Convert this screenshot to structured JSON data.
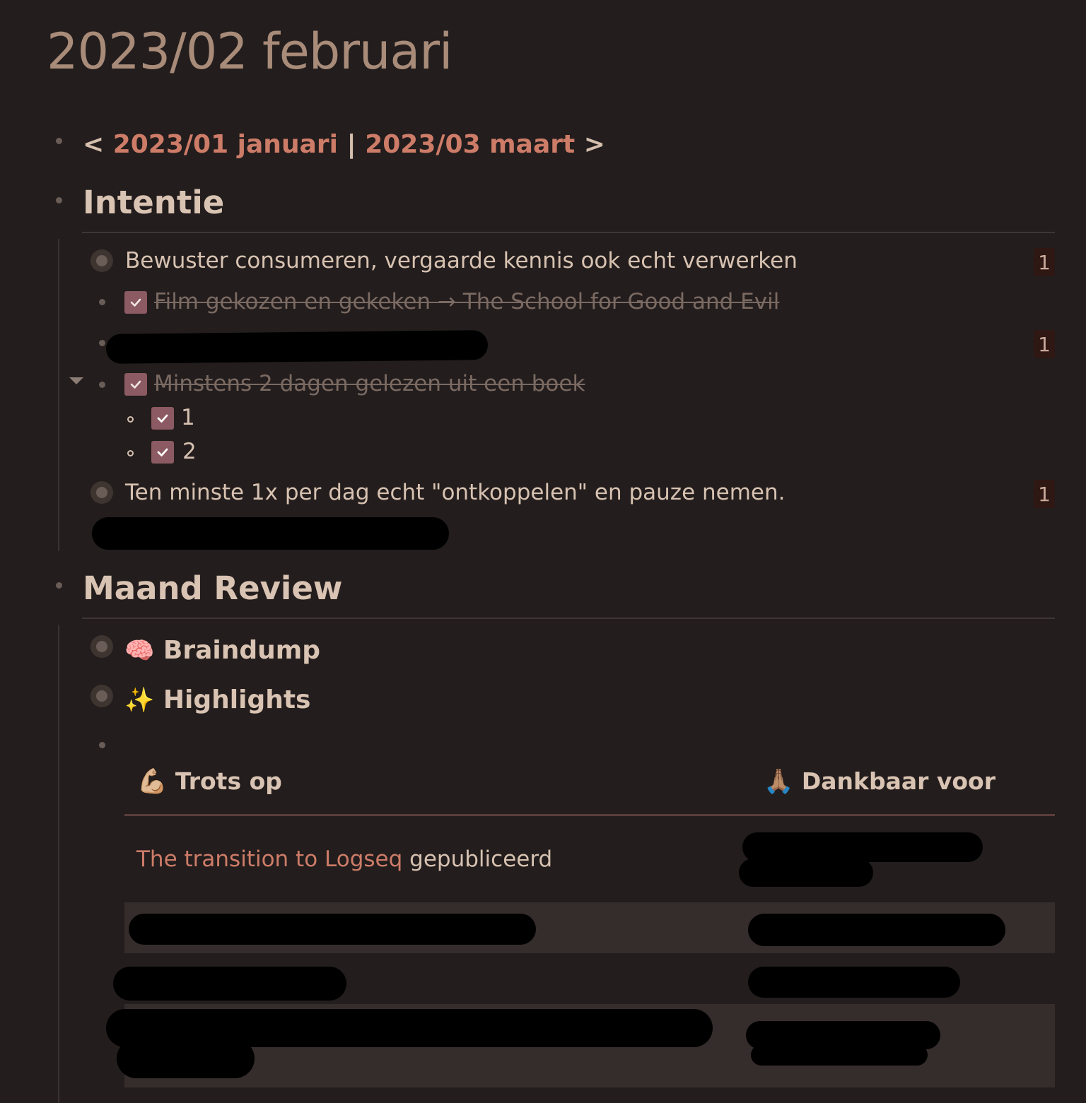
{
  "page": {
    "title": "2023/02 februari"
  },
  "nav": {
    "prev_prefix": "< ",
    "prev_link": "2023/01 januari",
    "separator": " | ",
    "next_link": "2023/03 maart",
    "next_suffix": " >"
  },
  "intentie": {
    "heading": "Intentie",
    "items": [
      {
        "text": "Bewuster consumeren, vergaarde kennis ook echt verwerken",
        "ref_count": "1"
      },
      {
        "text": "Film gekozen en gekeken → The School for Good and Evil",
        "done": true
      },
      {
        "text": "",
        "redacted": true,
        "ref_count": "1"
      },
      {
        "text": "Minstens 2 dagen gelezen uit een boek",
        "done": true,
        "children": [
          {
            "text": "1",
            "done": true
          },
          {
            "text": "2",
            "done": true
          }
        ]
      },
      {
        "text": "Ten minste 1x per dag echt \"ontkoppelen\" en pauze nemen.",
        "ref_count": "1"
      }
    ]
  },
  "review": {
    "heading": "Maand Review",
    "braindump": {
      "emoji": "🧠",
      "label": "Braindump"
    },
    "highlights": {
      "emoji": "✨",
      "label": "Highlights"
    },
    "table": {
      "col1": {
        "emoji": "💪🏼",
        "label": "Trots op"
      },
      "col2": {
        "emoji": "🙏🏽",
        "label": "Dankbaar voor"
      },
      "row1": {
        "link": "The transition to Logseq",
        "text": " gepubliceerd"
      }
    }
  },
  "colors": {
    "background": "#231d1d",
    "title": "#a88b78",
    "link": "#cd7c68",
    "checkbox": "#8b5a62",
    "text": "#d7c2b1"
  }
}
